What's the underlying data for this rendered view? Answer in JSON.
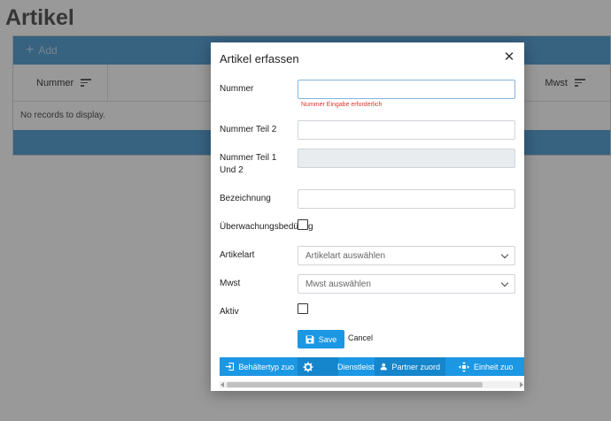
{
  "page": {
    "title": "Artikel",
    "toolbar": {
      "add_label": "Add"
    },
    "grid": {
      "columns": [
        "Nummer",
        "Mwst"
      ],
      "empty_message": "No records to display."
    }
  },
  "dialog": {
    "title": "Artikel erfassen",
    "fields": {
      "nummer": {
        "label": "Nummer",
        "value": "",
        "error": "Nummer Eingabe erforderlich"
      },
      "nummer_teil2": {
        "label": "Nummer Teil 2",
        "value": ""
      },
      "nummer_teil12": {
        "label": "Nummer Teil 1 Und 2",
        "value": ""
      },
      "bezeichnung": {
        "label": "Bezeichnung",
        "value": ""
      },
      "ueberwachung": {
        "label": "Überwachungsbedürftig",
        "checked": false
      },
      "artikelart": {
        "label": "Artikelart",
        "placeholder": "Artikelart auswählen"
      },
      "mwst": {
        "label": "Mwst",
        "placeholder": "Mwst auswählen"
      },
      "aktiv": {
        "label": "Aktiv",
        "checked": false
      }
    },
    "buttons": {
      "save": "Save",
      "cancel": "Cancel"
    },
    "tabs": [
      {
        "label": "Behältertyp zuo",
        "icon": "login-icon"
      },
      {
        "label": "",
        "icon": "gear-icon"
      },
      {
        "label": "Dienstleistu",
        "icon": ""
      },
      {
        "label": "Partner zuord",
        "icon": "person-icon"
      },
      {
        "label": "Einheit zuo",
        "icon": "move-icon"
      }
    ]
  },
  "colors": {
    "primary": "#1b97e4",
    "error": "#d9372c",
    "header_bar": "#5da3d6"
  }
}
